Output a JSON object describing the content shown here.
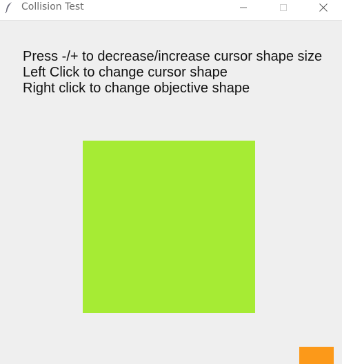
{
  "window": {
    "title": "Collision Test",
    "icon": "feather-icon"
  },
  "titlebar_controls": {
    "minimize_icon": "minimize-icon",
    "maximize_icon": "maximize-icon",
    "close_icon": "close-icon"
  },
  "instructions": {
    "line1": "Press -/+ to decrease/increase cursor shape size",
    "line2": "Left Click to change cursor shape",
    "line3": "Right click to change objective shape"
  },
  "canvas": {
    "background_color": "#efefef",
    "objective_shape": {
      "type": "square",
      "color": "#a6eb34"
    },
    "cursor_shape": {
      "type": "rectangle",
      "color": "#fc9919"
    }
  }
}
